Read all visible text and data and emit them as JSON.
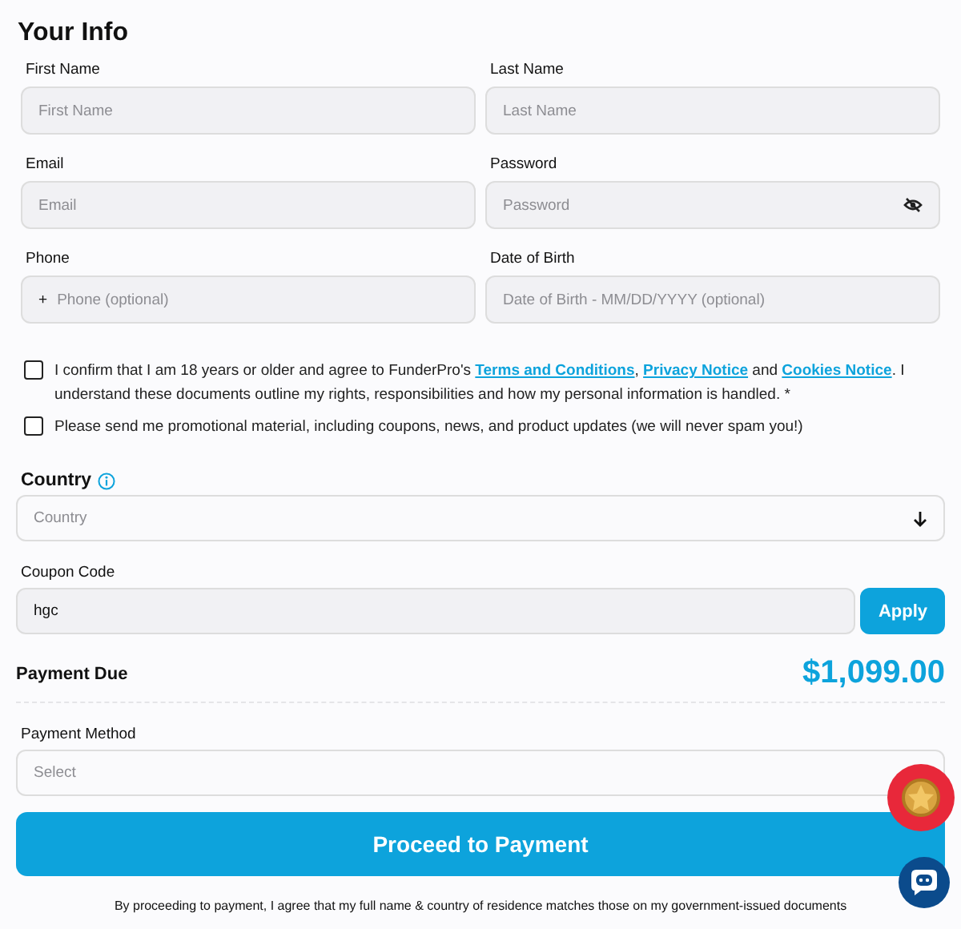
{
  "title": "Your Info",
  "fields": [
    {
      "kind": "text",
      "label": "First Name",
      "placeholder": "First Name"
    },
    {
      "kind": "text",
      "label": "Last Name",
      "placeholder": "Last Name"
    },
    {
      "kind": "text",
      "label": "Email",
      "placeholder": "Email"
    },
    {
      "kind": "password",
      "label": "Password",
      "placeholder": "Password"
    },
    {
      "kind": "phone",
      "label": "Phone",
      "placeholder": "Phone (optional)",
      "prefix": "+"
    },
    {
      "kind": "text",
      "label": "Date of Birth",
      "placeholder": "Date of Birth - MM/DD/YYYY (optional)"
    }
  ],
  "checkboxes": [
    {
      "checked": false,
      "parts": [
        {
          "kind": "text",
          "text": "I confirm that I am 18 years or older and agree to FunderPro's "
        },
        {
          "kind": "link",
          "text": "Terms and Conditions"
        },
        {
          "kind": "text",
          "text": ", "
        },
        {
          "kind": "link",
          "text": "Privacy Notice"
        },
        {
          "kind": "text",
          "text": " and "
        },
        {
          "kind": "link",
          "text": "Cookies Notice"
        },
        {
          "kind": "text",
          "text": ". I understand these documents outline my rights, responsibilities and how my personal information is handled. *"
        }
      ]
    },
    {
      "checked": false,
      "parts": [
        {
          "kind": "text",
          "text": "Please send me promotional material, including coupons, news, and product updates (we will never spam you!)"
        }
      ]
    }
  ],
  "country": {
    "label": "Country",
    "placeholder": "Country"
  },
  "coupon": {
    "label": "Coupon Code",
    "value": "hgc",
    "button": "Apply"
  },
  "payment_due": {
    "label": "Payment Due",
    "amount": "$1,099.00"
  },
  "payment_method": {
    "label": "Payment Method",
    "placeholder": "Select"
  },
  "submit": "Proceed to Payment",
  "disclaimer": "By proceeding to payment, I agree that my full name & country of residence matches those on my government-issued documents"
}
